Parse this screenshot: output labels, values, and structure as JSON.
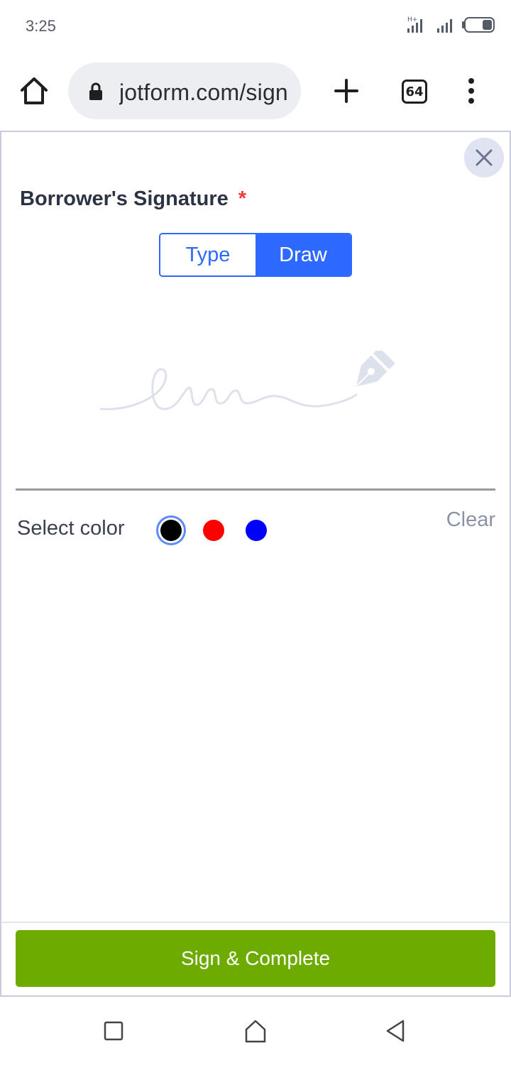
{
  "status_bar": {
    "time": "3:25",
    "signal_label": "H+",
    "icons": [
      "signal-icon",
      "signal-icon",
      "battery-icon"
    ]
  },
  "browser": {
    "url": "jotform.com/sign",
    "tab_count": "64",
    "icons": [
      "home-icon",
      "lock-icon",
      "plus-icon",
      "tabs-icon",
      "more-vert-icon"
    ]
  },
  "signature_modal": {
    "field_label": "Borrower's Signature",
    "required_marker": "*",
    "mode_tabs": [
      {
        "label": "Type",
        "selected": false
      },
      {
        "label": "Draw",
        "selected": true
      }
    ],
    "select_color_label": "Select color",
    "colors": [
      {
        "name": "black",
        "hex": "#000000",
        "selected": true
      },
      {
        "name": "red",
        "hex": "#ff0000",
        "selected": false
      },
      {
        "name": "blue",
        "hex": "#0000ff",
        "selected": false
      }
    ],
    "clear_label": "Clear",
    "submit_label": "Sign & Complete"
  },
  "colors": {
    "accent_blue": "#2e69ff",
    "submit_green": "#6eab00",
    "required_red": "#f23a3c"
  },
  "nav_bar": {
    "icons": [
      "recents-square-icon",
      "home-icon",
      "back-triangle-icon"
    ]
  }
}
